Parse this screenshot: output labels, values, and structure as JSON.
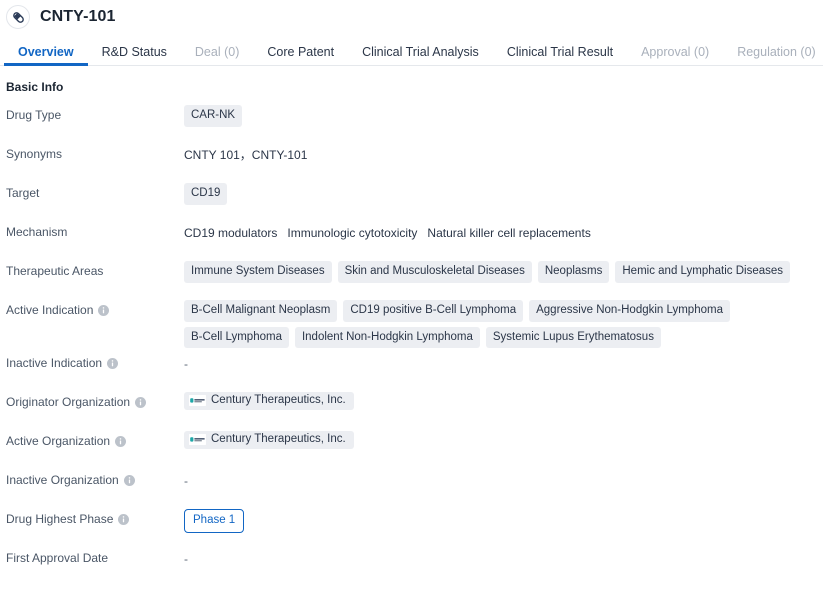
{
  "header": {
    "title": "CNTY-101",
    "icon": "capsule-icon"
  },
  "tabs": [
    {
      "label": "Overview",
      "state": "active"
    },
    {
      "label": "R&D Status",
      "state": "normal"
    },
    {
      "label": "Deal (0)",
      "state": "disabled"
    },
    {
      "label": "Core Patent",
      "state": "normal"
    },
    {
      "label": "Clinical Trial Analysis",
      "state": "normal"
    },
    {
      "label": "Clinical Trial Result",
      "state": "normal"
    },
    {
      "label": "Approval (0)",
      "state": "disabled"
    },
    {
      "label": "Regulation (0)",
      "state": "disabled"
    }
  ],
  "section": {
    "title": "Basic Info"
  },
  "fields": [
    {
      "name": "drug-type",
      "label": "Drug Type",
      "info": false,
      "type": "chips",
      "values": [
        "CAR-NK"
      ]
    },
    {
      "name": "synonyms",
      "label": "Synonyms",
      "info": false,
      "type": "text",
      "text": "CNTY 101，CNTY-101"
    },
    {
      "name": "target",
      "label": "Target",
      "info": false,
      "type": "chips",
      "values": [
        "CD19"
      ]
    },
    {
      "name": "mechanism",
      "label": "Mechanism",
      "info": false,
      "type": "inline-list",
      "values": [
        "CD19 modulators",
        "Immunologic cytotoxicity",
        "Natural killer cell replacements"
      ]
    },
    {
      "name": "therapeutic-areas",
      "label": "Therapeutic Areas",
      "info": false,
      "type": "chips",
      "values": [
        "Immune System Diseases",
        "Skin and Musculoskeletal Diseases",
        "Neoplasms",
        "Hemic and Lymphatic Diseases"
      ]
    },
    {
      "name": "active-indication",
      "label": "Active Indication",
      "info": true,
      "type": "chips",
      "values": [
        "B-Cell Malignant Neoplasm",
        "CD19 positive B-Cell Lymphoma",
        "Aggressive Non-Hodgkin Lymphoma",
        "B-Cell Lymphoma",
        "Indolent Non-Hodgkin Lymphoma",
        "Systemic Lupus Erythematosus"
      ]
    },
    {
      "name": "inactive-indication",
      "label": "Inactive Indication",
      "info": true,
      "type": "dash",
      "text": "-"
    },
    {
      "name": "originator-organization",
      "label": "Originator Organization",
      "info": true,
      "type": "org-chips",
      "values": [
        "Century Therapeutics, Inc."
      ]
    },
    {
      "name": "active-organization",
      "label": "Active Organization",
      "info": true,
      "type": "org-chips",
      "values": [
        "Century Therapeutics, Inc."
      ]
    },
    {
      "name": "inactive-organization",
      "label": "Inactive Organization",
      "info": true,
      "type": "dash",
      "text": "-"
    },
    {
      "name": "drug-highest-phase",
      "label": "Drug Highest Phase",
      "info": true,
      "type": "phase",
      "text": "Phase 1"
    },
    {
      "name": "first-approval-date",
      "label": "First Approval Date",
      "info": false,
      "type": "dash",
      "text": "-"
    }
  ],
  "colors": {
    "accent": "#1266c4",
    "chip_bg": "#eceef2",
    "text": "#2b3648",
    "label": "#4a5666",
    "muted": "#a9b0bb"
  }
}
